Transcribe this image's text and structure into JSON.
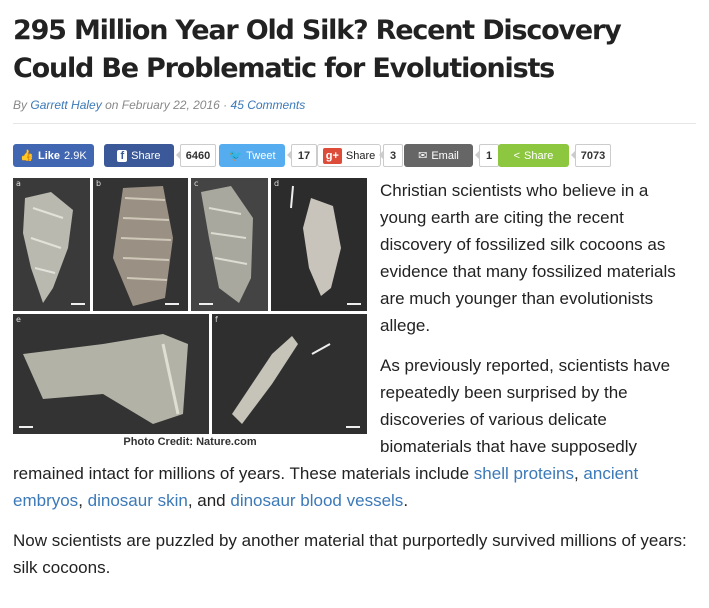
{
  "article": {
    "title": "295 Million Year Old Silk? Recent Discovery Could Be Problematic for Evolutionists",
    "byline_by": "By",
    "author": "Garrett Haley",
    "byline_on": "on",
    "date": "February 22, 2016",
    "separator": "·",
    "comments": "45 Comments"
  },
  "share": {
    "like_label": "Like",
    "like_count": "2.9K",
    "fb_share_label": "Share",
    "fb_share_count": "6460",
    "tweet_label": "Tweet",
    "tweet_count": "17",
    "gplus_label": "Share",
    "gplus_count": "3",
    "email_label": "Email",
    "email_count": "1",
    "share_label": "Share",
    "share_count": "7073"
  },
  "figure": {
    "panel_labels": [
      "a",
      "b",
      "c",
      "d",
      "e",
      "f"
    ],
    "credit": "Photo Credit: Nature.com"
  },
  "paragraphs": {
    "p1": "Christian scientists who believe in a young earth are citing the recent discovery of fossilized silk cocoons as evidence that many fossilized materials are much younger than evolutionists allege.",
    "p2_start": "As previously reported, scientists have repeatedly been surprised by the discoveries of various delicate biomaterials that have supposedly remained intact for millions of years. These materials include ",
    "link_shell": "shell proteins",
    "comma1": ", ",
    "link_embryos": "ancient embryos",
    "comma2": ", ",
    "link_skin": "dinosaur skin",
    "and": ", and ",
    "link_vessels": "dinosaur blood vessels",
    "period": ".",
    "p3": "Now scientists are puzzled by another material that purportedly survived millions of years: silk cocoons."
  }
}
